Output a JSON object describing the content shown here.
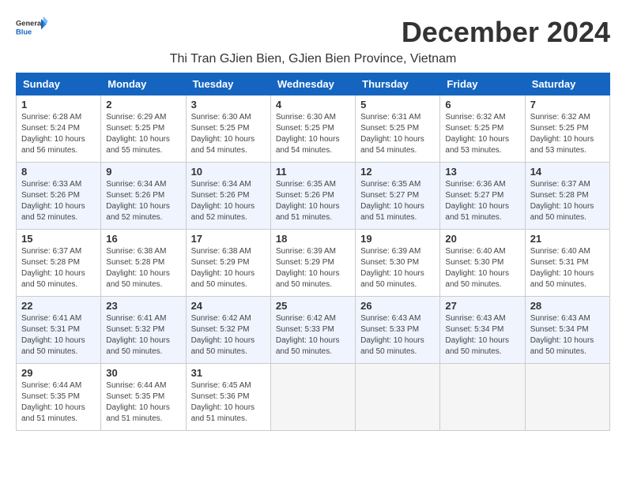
{
  "header": {
    "logo_general": "General",
    "logo_blue": "Blue",
    "month_title": "December 2024",
    "location": "Thi Tran GJien Bien, GJien Bien Province, Vietnam"
  },
  "days_of_week": [
    "Sunday",
    "Monday",
    "Tuesday",
    "Wednesday",
    "Thursday",
    "Friday",
    "Saturday"
  ],
  "weeks": [
    [
      {
        "day": "1",
        "sunrise": "6:28 AM",
        "sunset": "5:24 PM",
        "daylight": "10 hours and 56 minutes."
      },
      {
        "day": "2",
        "sunrise": "6:29 AM",
        "sunset": "5:25 PM",
        "daylight": "10 hours and 55 minutes."
      },
      {
        "day": "3",
        "sunrise": "6:30 AM",
        "sunset": "5:25 PM",
        "daylight": "10 hours and 54 minutes."
      },
      {
        "day": "4",
        "sunrise": "6:30 AM",
        "sunset": "5:25 PM",
        "daylight": "10 hours and 54 minutes."
      },
      {
        "day": "5",
        "sunrise": "6:31 AM",
        "sunset": "5:25 PM",
        "daylight": "10 hours and 54 minutes."
      },
      {
        "day": "6",
        "sunrise": "6:32 AM",
        "sunset": "5:25 PM",
        "daylight": "10 hours and 53 minutes."
      },
      {
        "day": "7",
        "sunrise": "6:32 AM",
        "sunset": "5:25 PM",
        "daylight": "10 hours and 53 minutes."
      }
    ],
    [
      {
        "day": "8",
        "sunrise": "6:33 AM",
        "sunset": "5:26 PM",
        "daylight": "10 hours and 52 minutes."
      },
      {
        "day": "9",
        "sunrise": "6:34 AM",
        "sunset": "5:26 PM",
        "daylight": "10 hours and 52 minutes."
      },
      {
        "day": "10",
        "sunrise": "6:34 AM",
        "sunset": "5:26 PM",
        "daylight": "10 hours and 52 minutes."
      },
      {
        "day": "11",
        "sunrise": "6:35 AM",
        "sunset": "5:26 PM",
        "daylight": "10 hours and 51 minutes."
      },
      {
        "day": "12",
        "sunrise": "6:35 AM",
        "sunset": "5:27 PM",
        "daylight": "10 hours and 51 minutes."
      },
      {
        "day": "13",
        "sunrise": "6:36 AM",
        "sunset": "5:27 PM",
        "daylight": "10 hours and 51 minutes."
      },
      {
        "day": "14",
        "sunrise": "6:37 AM",
        "sunset": "5:28 PM",
        "daylight": "10 hours and 50 minutes."
      }
    ],
    [
      {
        "day": "15",
        "sunrise": "6:37 AM",
        "sunset": "5:28 PM",
        "daylight": "10 hours and 50 minutes."
      },
      {
        "day": "16",
        "sunrise": "6:38 AM",
        "sunset": "5:28 PM",
        "daylight": "10 hours and 50 minutes."
      },
      {
        "day": "17",
        "sunrise": "6:38 AM",
        "sunset": "5:29 PM",
        "daylight": "10 hours and 50 minutes."
      },
      {
        "day": "18",
        "sunrise": "6:39 AM",
        "sunset": "5:29 PM",
        "daylight": "10 hours and 50 minutes."
      },
      {
        "day": "19",
        "sunrise": "6:39 AM",
        "sunset": "5:30 PM",
        "daylight": "10 hours and 50 minutes."
      },
      {
        "day": "20",
        "sunrise": "6:40 AM",
        "sunset": "5:30 PM",
        "daylight": "10 hours and 50 minutes."
      },
      {
        "day": "21",
        "sunrise": "6:40 AM",
        "sunset": "5:31 PM",
        "daylight": "10 hours and 50 minutes."
      }
    ],
    [
      {
        "day": "22",
        "sunrise": "6:41 AM",
        "sunset": "5:31 PM",
        "daylight": "10 hours and 50 minutes."
      },
      {
        "day": "23",
        "sunrise": "6:41 AM",
        "sunset": "5:32 PM",
        "daylight": "10 hours and 50 minutes."
      },
      {
        "day": "24",
        "sunrise": "6:42 AM",
        "sunset": "5:32 PM",
        "daylight": "10 hours and 50 minutes."
      },
      {
        "day": "25",
        "sunrise": "6:42 AM",
        "sunset": "5:33 PM",
        "daylight": "10 hours and 50 minutes."
      },
      {
        "day": "26",
        "sunrise": "6:43 AM",
        "sunset": "5:33 PM",
        "daylight": "10 hours and 50 minutes."
      },
      {
        "day": "27",
        "sunrise": "6:43 AM",
        "sunset": "5:34 PM",
        "daylight": "10 hours and 50 minutes."
      },
      {
        "day": "28",
        "sunrise": "6:43 AM",
        "sunset": "5:34 PM",
        "daylight": "10 hours and 50 minutes."
      }
    ],
    [
      {
        "day": "29",
        "sunrise": "6:44 AM",
        "sunset": "5:35 PM",
        "daylight": "10 hours and 51 minutes."
      },
      {
        "day": "30",
        "sunrise": "6:44 AM",
        "sunset": "5:35 PM",
        "daylight": "10 hours and 51 minutes."
      },
      {
        "day": "31",
        "sunrise": "6:45 AM",
        "sunset": "5:36 PM",
        "daylight": "10 hours and 51 minutes."
      },
      null,
      null,
      null,
      null
    ]
  ]
}
